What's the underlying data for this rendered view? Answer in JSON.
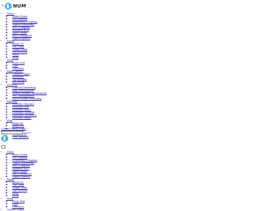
{
  "brand": {
    "name": "NUM"
  },
  "menu": [
    {
      "label": "Home",
      "children": [
        "Home Demo",
        "SEO Agency",
        "Marketing Company",
        "Digital Marketing",
        "SEO Company",
        "Business SEO",
        "Agile Media",
        "SEO Consultant",
        "Digital Agency"
      ]
    },
    {
      "label": "Pages",
      "children": [
        "About Us",
        "Our Team",
        "Single Team",
        "Our Process",
        "FAQs",
        "Shop"
      ]
    },
    {
      "label": "Shop",
      "children": [
        "Shop Grid",
        "Cart",
        "Checkout"
      ]
    },
    {
      "label": "Pages (more)",
      "children": [
        "Contact Pages",
        "Elements",
        "Typography",
        "404 Error"
      ]
    },
    {
      "label": "Services",
      "children": [
        "Content Marketing",
        "App Development",
        "Search Engine Optimization",
        "PPC Management",
        "Social Media Marketing"
      ]
    },
    {
      "label": "Portfolio",
      "children": [
        "Portfolio Masonry",
        "Portfolio Grid",
        "Portfolio Grid 2",
        "Portfolio Carousel",
        "Portfolio Carousel 2",
        "Portfolio Single"
      ]
    },
    {
      "label": "Blog",
      "children": [
        "Blog List",
        "Blog Grid",
        "Blog Single"
      ]
    },
    {
      "label": "Contacts",
      "children": [
        "Contacts 01",
        "Free Analysis"
      ]
    }
  ],
  "contact_link": "Contact Us",
  "search_button": "Search",
  "menu2": [
    {
      "label": "Home",
      "children": [
        "Home Demo",
        "SEO Agency",
        "Marketing Company",
        "Digital Marketing",
        "SEO Company",
        "Business SEO",
        "Agile Media",
        "SEO Consultant",
        "Digital Agency"
      ]
    },
    {
      "label": "Pages",
      "children": [
        "About Us",
        "Our Team",
        "Single Team",
        "Our Process",
        "FAQs",
        "Shop"
      ]
    },
    {
      "label": "Shop",
      "children": [
        "Shop Grid",
        "Cart",
        "Checkout"
      ]
    },
    {
      "label": "Contact Pages",
      "children": []
    }
  ],
  "colors": {
    "link": "#1a0dab",
    "brand_blue": "#33b5e8",
    "accent_red": "#e53935"
  }
}
